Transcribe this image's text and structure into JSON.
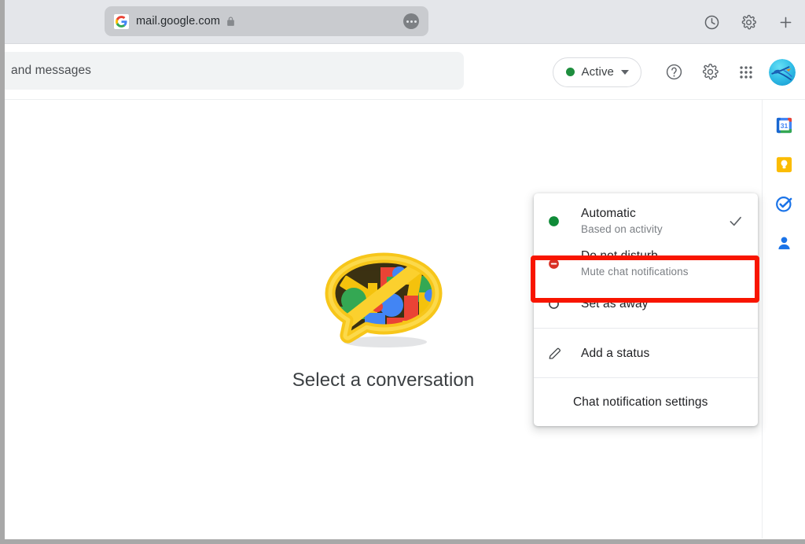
{
  "browser": {
    "tab": {
      "favicon": "google-g-icon",
      "title": "mail.google.com",
      "lock": "lock-icon",
      "menu": "tab-overflow-icon"
    },
    "actions": [
      {
        "name": "history-icon",
        "label": "History"
      },
      {
        "name": "browser-settings-icon",
        "label": "Settings"
      },
      {
        "name": "new-tab-icon",
        "label": "New tab"
      }
    ]
  },
  "header": {
    "search": {
      "value": "and messages",
      "placeholder": "Search mail and messages"
    },
    "status_chip": {
      "label": "Active",
      "dot_color": "#1e8e3e",
      "caret": "chevron-down-icon"
    },
    "icons": [
      {
        "name": "help-icon",
        "label": "Support"
      },
      {
        "name": "settings-gear-icon",
        "label": "Settings"
      },
      {
        "name": "apps-grid-icon",
        "label": "Google apps"
      }
    ],
    "avatar": {
      "name": "account-avatar",
      "label": "Google Account"
    }
  },
  "status_menu": {
    "items": [
      {
        "icon": "active-dot-icon",
        "title": "Automatic",
        "subtitle": "Based on activity",
        "selected": true,
        "check": "checkmark-icon"
      },
      {
        "icon": "do-not-disturb-icon",
        "title": "Do not disturb",
        "subtitle": "Mute chat notifications",
        "selected": false,
        "highlighted": true
      },
      {
        "icon": "away-circle-icon",
        "title": "Set as away",
        "subtitle": "",
        "selected": false
      },
      {
        "icon": "pencil-icon",
        "title": "Add a status",
        "subtitle": "",
        "selected": false
      },
      {
        "icon": "",
        "title": "Chat notification settings",
        "subtitle": "",
        "selected": false
      }
    ]
  },
  "right_rail": {
    "items": [
      {
        "name": "google-calendar-icon",
        "label": "Calendar",
        "badge": "31"
      },
      {
        "name": "google-keep-icon",
        "label": "Keep"
      },
      {
        "name": "google-tasks-icon",
        "label": "Tasks"
      },
      {
        "name": "google-contacts-icon",
        "label": "Contacts"
      }
    ]
  },
  "main": {
    "empty_state": {
      "illustration": "chat-bubble-illustration",
      "label": "Select a conversation"
    }
  },
  "annotation": {
    "highlight_color": "#f81500",
    "target": "do-not-disturb-menu-item"
  }
}
